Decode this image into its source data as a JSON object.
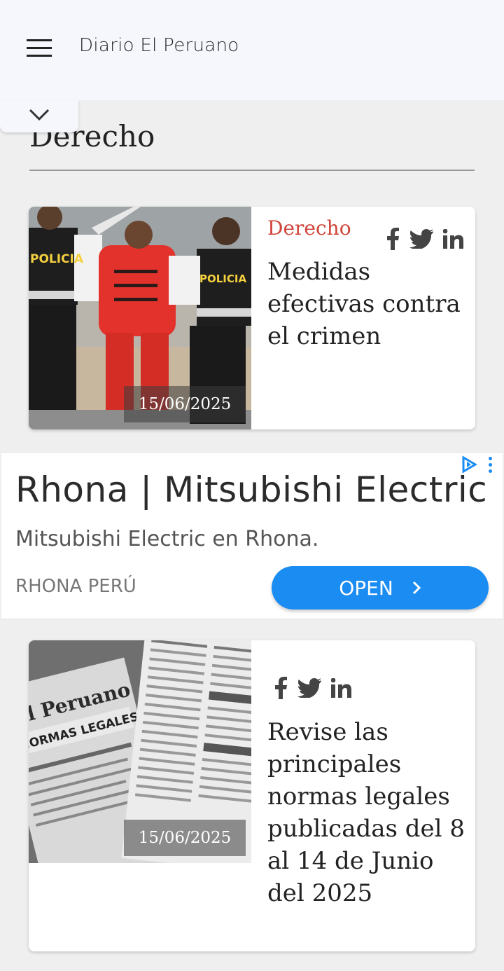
{
  "header": {
    "site_title": "Diario El Peruano"
  },
  "section": {
    "title": "Derecho"
  },
  "articles": [
    {
      "category": "Derecho",
      "date": "15/06/2025",
      "headline": "Medidas efectivas contra el crimen",
      "image": "police-escorting-detainee"
    },
    {
      "category": "",
      "date": "15/06/2025",
      "headline": "Revise las principales normas legales publicadas del 8 al 14 de Junio del 2025",
      "image": "el-peruano-normas-legales-newspaper"
    }
  ],
  "ad": {
    "title": "Rhona | Mitsubishi Electric",
    "description": "Mitsubishi Electric en Rhona.",
    "advertiser": "RHONA PERÚ",
    "cta": "OPEN"
  },
  "social_icons": [
    "facebook-icon",
    "twitter-icon",
    "linkedin-icon"
  ],
  "colors": {
    "accent_red": "#d0453a",
    "ad_button_blue": "#1a8cf2"
  }
}
